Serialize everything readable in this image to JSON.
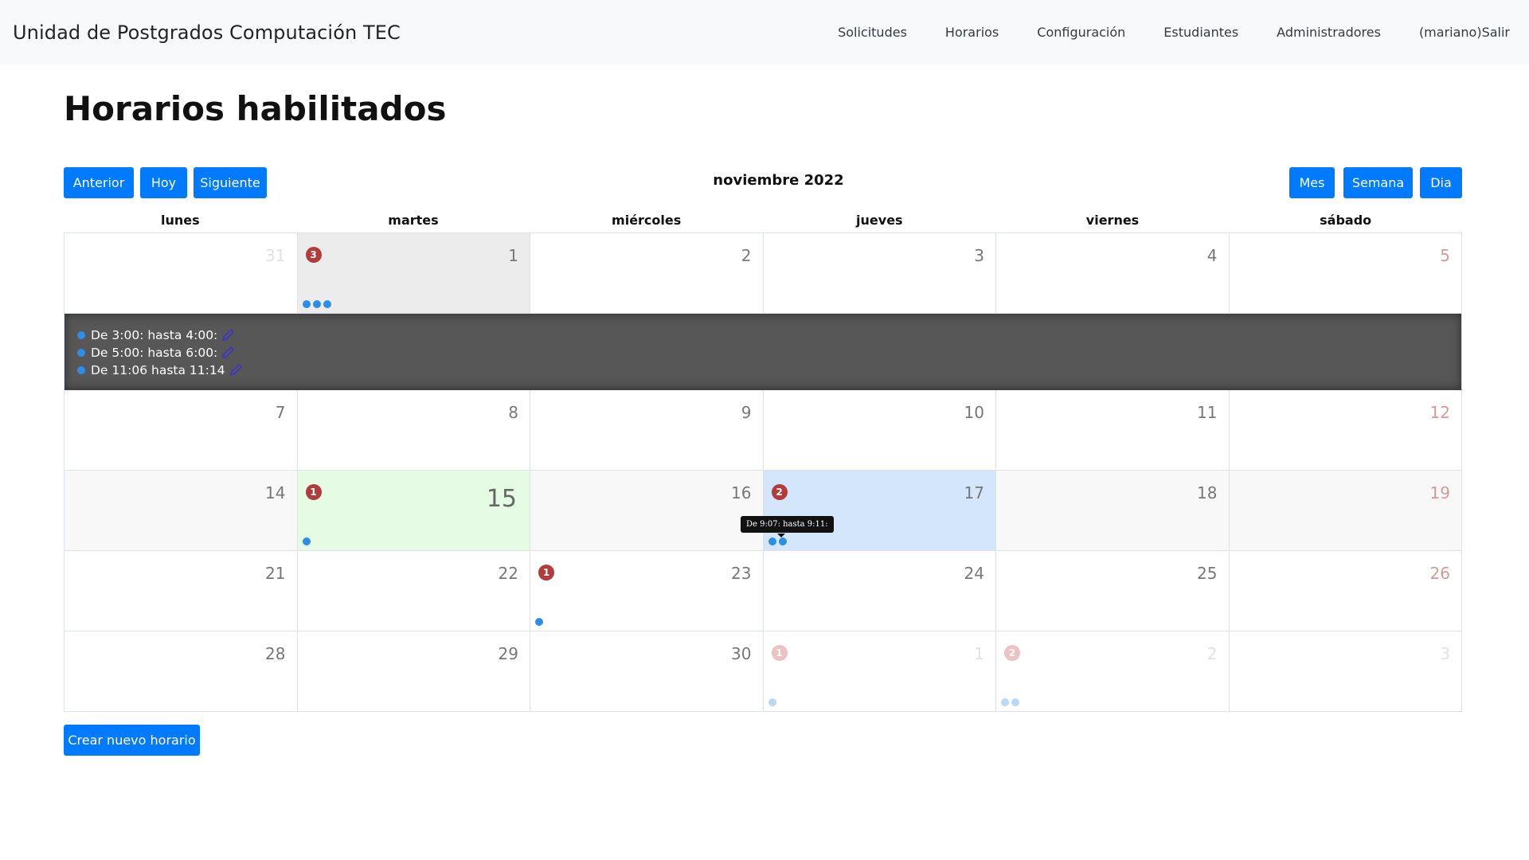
{
  "navbar": {
    "brand": "Unidad de Postgrados Computación TEC",
    "links": [
      "Solicitudes",
      "Horarios",
      "Configuración",
      "Estudiantes",
      "Administradores",
      "(mariano)Salir"
    ]
  },
  "page": {
    "title": "Horarios habilitados"
  },
  "toolbar": {
    "prev": "Anterior",
    "today": "Hoy",
    "next": "Siguiente",
    "month_label": "noviembre 2022",
    "view_month": "Mes",
    "view_week": "Semana",
    "view_day": "Dia"
  },
  "calendar": {
    "weekdays": [
      "lunes",
      "martes",
      "miércoles",
      "jueves",
      "viernes",
      "sábado"
    ],
    "weeks": [
      [
        {
          "num": "31",
          "state": "faded"
        },
        {
          "num": "1",
          "state": "selected",
          "badge": "3",
          "dots": 3
        },
        {
          "num": "2"
        },
        {
          "num": "3"
        },
        {
          "num": "4"
        },
        {
          "num": "5",
          "weekend": true
        }
      ],
      [
        {
          "num": "7"
        },
        {
          "num": "8"
        },
        {
          "num": "9"
        },
        {
          "num": "10"
        },
        {
          "num": "11"
        },
        {
          "num": "12",
          "weekend": true
        }
      ],
      [
        {
          "num": "14",
          "state": "shaded"
        },
        {
          "num": "15",
          "state": "today",
          "badge": "1",
          "dots": 1
        },
        {
          "num": "16",
          "state": "shaded"
        },
        {
          "num": "17",
          "state": "highlight",
          "badge": "2",
          "dots": 2
        },
        {
          "num": "18",
          "state": "shaded"
        },
        {
          "num": "19",
          "state": "shaded",
          "weekend": true
        }
      ],
      [
        {
          "num": "21"
        },
        {
          "num": "22"
        },
        {
          "num": "23",
          "badge": "1",
          "dots": 1
        },
        {
          "num": "24"
        },
        {
          "num": "25"
        },
        {
          "num": "26",
          "weekend": true
        }
      ],
      [
        {
          "num": "28"
        },
        {
          "num": "29"
        },
        {
          "num": "30"
        },
        {
          "num": "1",
          "state": "faded",
          "badge": "1",
          "dots": 1
        },
        {
          "num": "2",
          "state": "faded",
          "badge": "2",
          "dots": 2
        },
        {
          "num": "3",
          "state": "faded"
        }
      ]
    ],
    "expanded_events": [
      "De 3:00: hasta 4:00:",
      "De 5:00: hasta 6:00:",
      "De 11:06 hasta 11:14"
    ],
    "tooltip": "De 9:07: hasta 9:11:"
  },
  "actions": {
    "create": "Crear nuevo horario"
  },
  "colors": {
    "primary": "#007bff",
    "badge": "#b23b3b",
    "dot": "#2d8ee8",
    "today": "#e6fbe4",
    "highlight": "#d3e6fb"
  }
}
